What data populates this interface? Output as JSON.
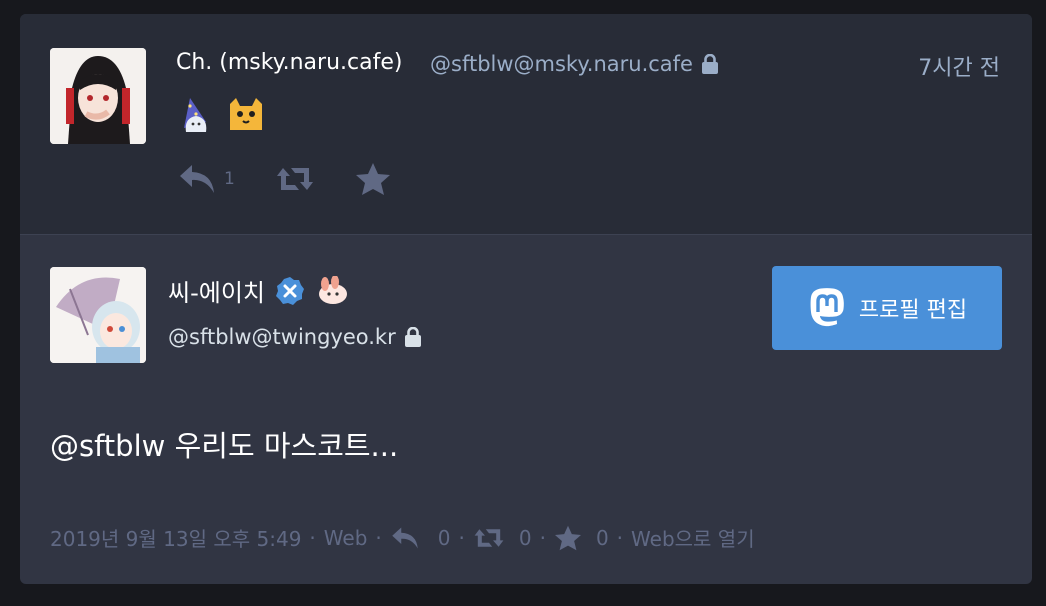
{
  "status": {
    "display_name": "Ch. (msky.naru.cafe)",
    "acct": "@sftblw@msky.naru.cafe",
    "relative_time": "7시간 전",
    "emojis": [
      "wizard-ghost-emoji",
      "cat-face-emoji"
    ],
    "actions": {
      "reply_count": "1",
      "reply_icon": "reply-icon",
      "boost_icon": "boost-icon",
      "favourite_icon": "star-icon"
    }
  },
  "detail": {
    "display_name": "씨-에이치",
    "acct": "@sftblw@twingyeo.kr",
    "edit_profile_label": "프로필 편집",
    "content": "@sftblw 우리도 마스코트...",
    "meta": {
      "datetime": "2019년 9월 13일 오후 5:49",
      "application": "Web",
      "reply_count": "0",
      "boost_count": "0",
      "favourite_count": "0",
      "open_in_web": "Web으로 열기"
    }
  },
  "colors": {
    "background": "#17181d",
    "status_bg": "#282c37",
    "detail_bg": "#313543",
    "accent": "#4a90d9",
    "muted": "#606984",
    "secondary_text": "#9baec8"
  }
}
